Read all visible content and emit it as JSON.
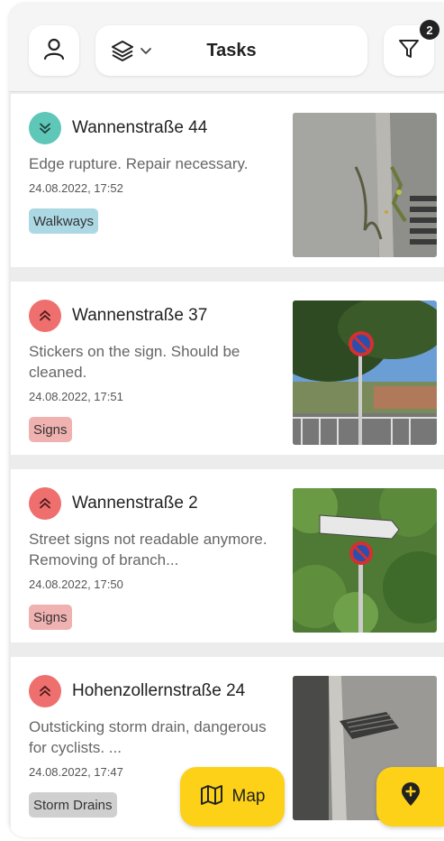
{
  "header": {
    "title": "Tasks",
    "filter_count": "2",
    "user_icon": "user-icon",
    "layers_icon": "layers-icon",
    "filter_icon": "filter-icon"
  },
  "tasks": [
    {
      "address": "Wannenstraße 44",
      "description": "Edge rupture. Repair necessary.",
      "date": "24.08.2022, 17:52",
      "category": "Walkways",
      "priority": "low",
      "photo": "sidewalk-curb-photo"
    },
    {
      "address": "Wannenstraße 37",
      "description": "Stickers on the sign. Should be cleaned.",
      "date": "24.08.2022, 17:51",
      "category": "Signs",
      "priority": "high",
      "photo": "no-parking-sign-photo"
    },
    {
      "address": "Wannenstraße 2",
      "description": "Street signs not readable anymore. Removing of branch...",
      "date": "24.08.2022, 17:50",
      "category": "Signs",
      "priority": "high",
      "photo": "street-sign-branches-photo"
    },
    {
      "address": "Hohenzollernstraße 24",
      "description": "Outsticking storm drain, dangerous for cyclists. ...",
      "date": "24.08.2022, 17:47",
      "category": "Storm Drains",
      "priority": "high",
      "photo": "storm-drain-photo"
    }
  ],
  "actions": {
    "map_label": "Map",
    "map_icon": "map-icon",
    "add_icon": "add-location-icon"
  },
  "colors": {
    "accent": "#fcd117",
    "priority_low": "#5ec7b8",
    "priority_high": "#ee6f6d",
    "tag_walkways": "#acd8e4",
    "tag_signs": "#f0b2b1",
    "tag_storm_drains": "#cfcfcf"
  }
}
